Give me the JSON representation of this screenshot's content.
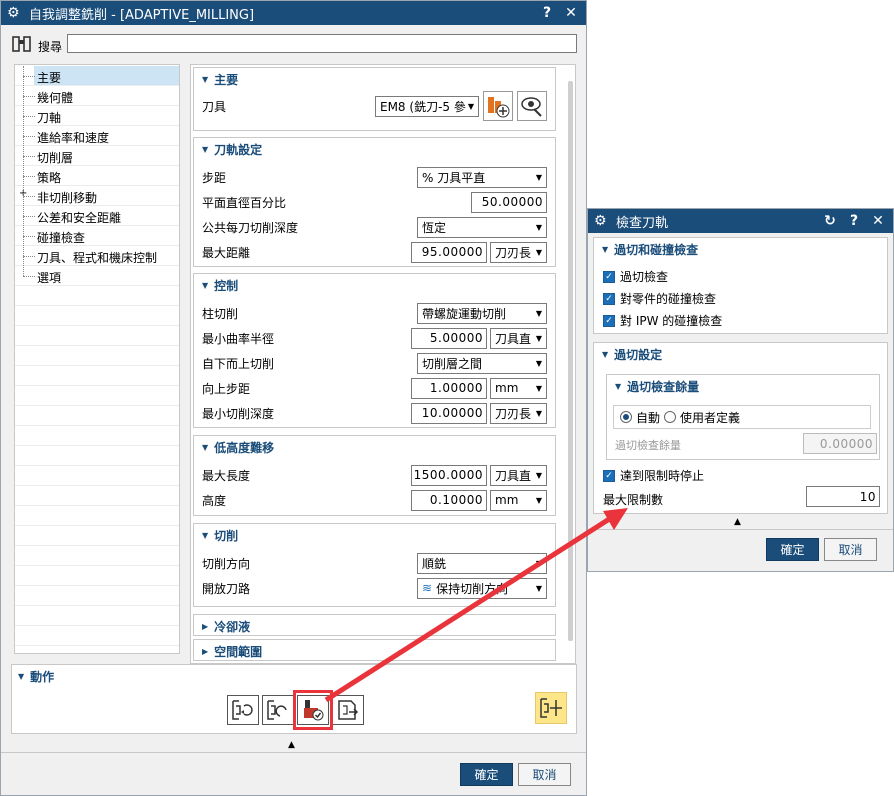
{
  "main_dialog": {
    "title": "自我調整銑削 - [ADAPTIVE_MILLING]",
    "help": "?",
    "close": "✕",
    "search_label": "搜尋",
    "search_value": "",
    "tree": [
      {
        "label": "主要"
      },
      {
        "label": "幾何體"
      },
      {
        "label": "刀軸"
      },
      {
        "label": "進給率和速度"
      },
      {
        "label": "切削層"
      },
      {
        "label": "策略"
      },
      {
        "label": "非切削移動",
        "expand": "+"
      },
      {
        "label": "公差和安全距離"
      },
      {
        "label": "碰撞檢查"
      },
      {
        "label": "刀具、程式和機床控制"
      },
      {
        "label": "選項"
      }
    ],
    "sections": {
      "main": {
        "title": "主要",
        "tool_label": "刀具",
        "tool_value": "EM8 (銑刀-5 參"
      },
      "path": {
        "title": "刀軌設定",
        "stepover_label": "步距",
        "stepover_value": "% 刀具平直",
        "pct_label": "平面直徑百分比",
        "pct_value": "50.00000",
        "depth_label": "公共每刀切削深度",
        "depth_value": "恆定",
        "maxdist_label": "最大距離",
        "maxdist_value": "95.00000",
        "maxdist_unit": "刀刃長"
      },
      "control": {
        "title": "控制",
        "col_label": "柱切削",
        "col_value": "帶螺旋運動切削",
        "radius_label": "最小曲率半徑",
        "radius_value": "5.00000",
        "radius_unit": "刀具直",
        "bottomup_label": "自下而上切削",
        "bottomup_value": "切削層之間",
        "upstep_label": "向上步距",
        "upstep_value": "1.00000",
        "upstep_unit": "mm",
        "mindepth_label": "最小切削深度",
        "mindepth_value": "10.00000",
        "mindepth_unit": "刀刃長"
      },
      "lowheight": {
        "title": "低高度難移",
        "maxlen_label": "最大長度",
        "maxlen_value": "1500.0000",
        "maxlen_unit": "刀具直",
        "height_label": "高度",
        "height_value": "0.10000",
        "height_unit": "mm"
      },
      "cut": {
        "title": "切削",
        "dir_label": "切削方向",
        "dir_value": "順銑",
        "open_label": "開放刀路",
        "open_value": "保持切削方向"
      },
      "coolant": {
        "title": "冷卻液"
      },
      "space": {
        "title": "空間範圍"
      }
    },
    "actions_title": "動作",
    "ok": "確定",
    "cancel": "取消"
  },
  "check_dialog": {
    "title": "檢查刀軌",
    "reset": "↻",
    "help": "?",
    "close": "✕",
    "group1_title": "過切和碰撞檢查",
    "opt1": "過切檢查",
    "opt2": "對零件的碰撞檢查",
    "opt3": "對 IPW 的碰撞檢查",
    "group2_title": "過切設定",
    "sub_title": "過切檢查餘量",
    "radio_auto": "自動",
    "radio_user": "使用者定義",
    "allowance_label": "過切檢查餘量",
    "allowance_value": "0.00000",
    "stop_label": "達到限制時停止",
    "max_label": "最大限制數",
    "max_value": "10",
    "ok": "確定",
    "cancel": "取消"
  },
  "colors": {
    "title_bar": "#1b4d7a",
    "accent": "#1b6fb8",
    "highlight_box": "#e8343a",
    "selected_tree": "#cde4f5"
  }
}
